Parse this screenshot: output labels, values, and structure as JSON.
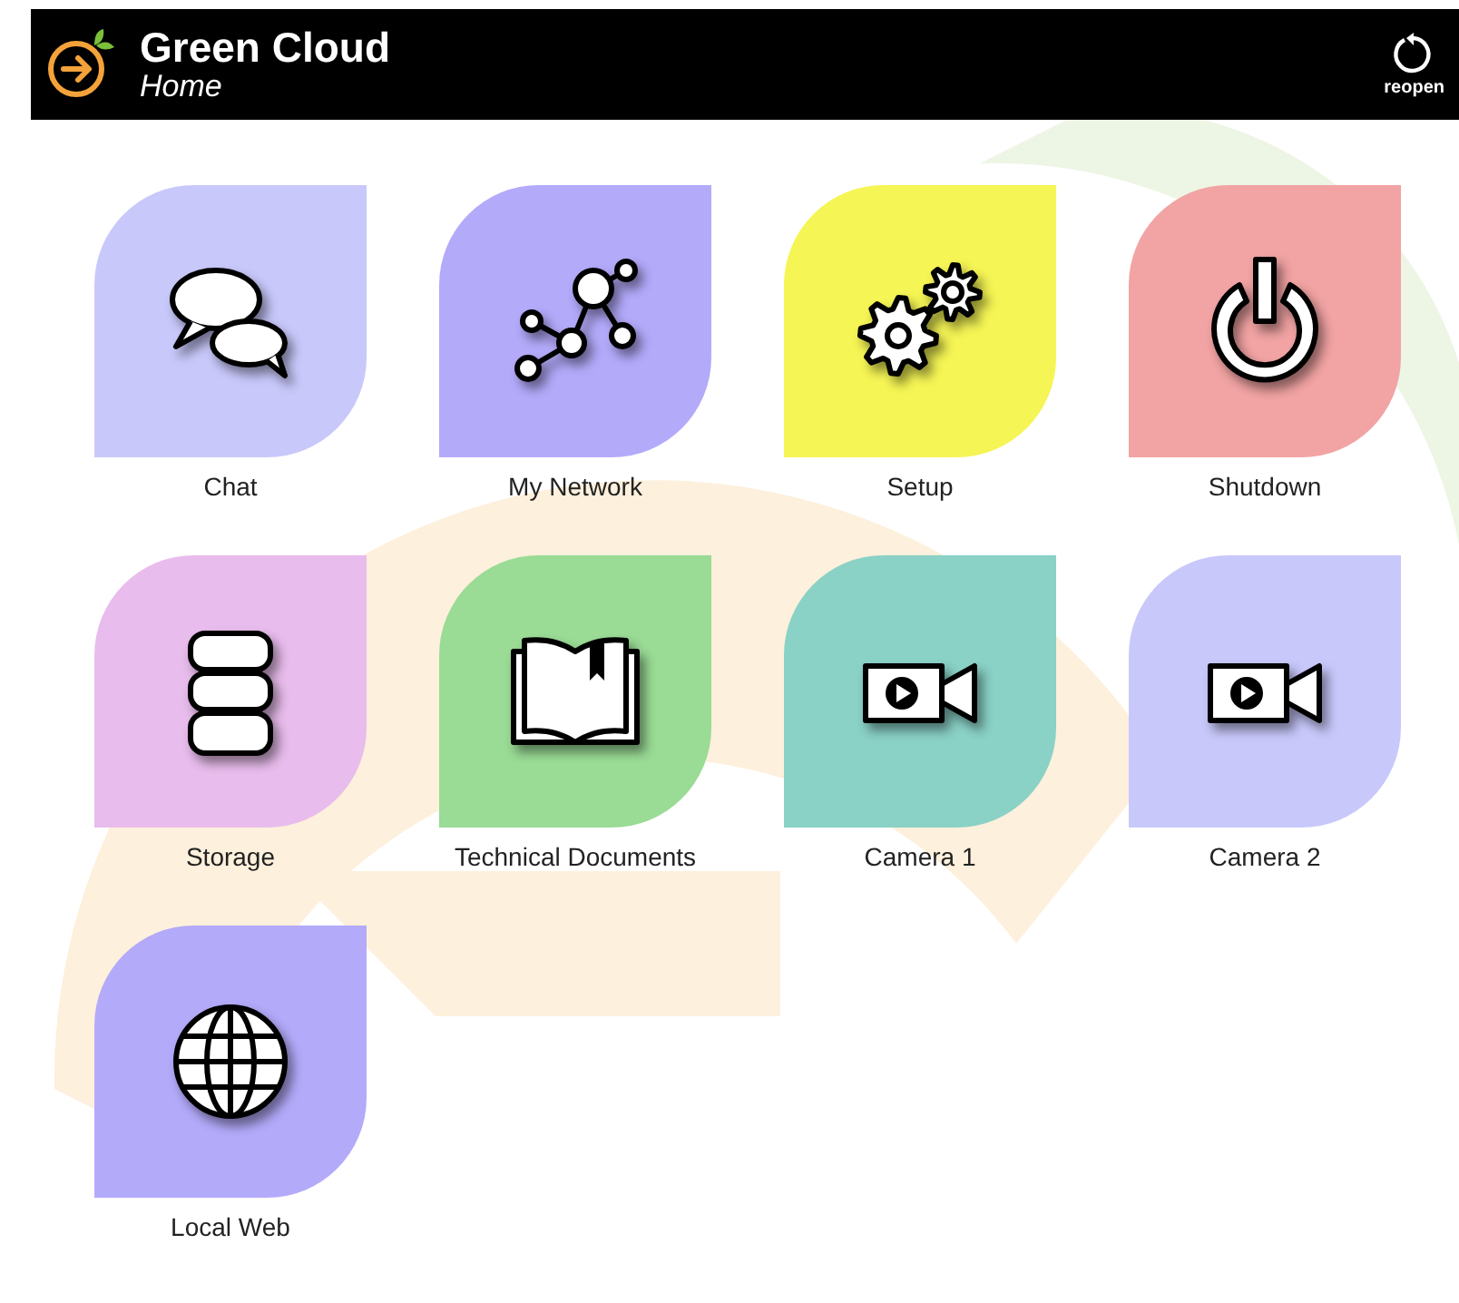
{
  "header": {
    "title": "Green Cloud",
    "subtitle": "Home",
    "action": "reopen"
  },
  "apps": [
    {
      "label": "Chat",
      "kind": "chat",
      "color": "#c8c8fb"
    },
    {
      "label": "My Network",
      "kind": "network",
      "color": "#b3aafa"
    },
    {
      "label": "Setup",
      "kind": "gears",
      "color": "#f5f555"
    },
    {
      "label": "Shutdown",
      "kind": "power",
      "color": "#f2a3a3"
    },
    {
      "label": "Storage",
      "kind": "database",
      "color": "#e8bcec"
    },
    {
      "label": "Technical Documents",
      "kind": "book",
      "color": "#9adb95"
    },
    {
      "label": "Camera 1",
      "kind": "camera",
      "color": "#8ad1c6"
    },
    {
      "label": "Camera 2",
      "kind": "camera",
      "color": "#c8c8fb"
    },
    {
      "label": "Local Web",
      "kind": "globe",
      "color": "#b3aafa"
    }
  ]
}
